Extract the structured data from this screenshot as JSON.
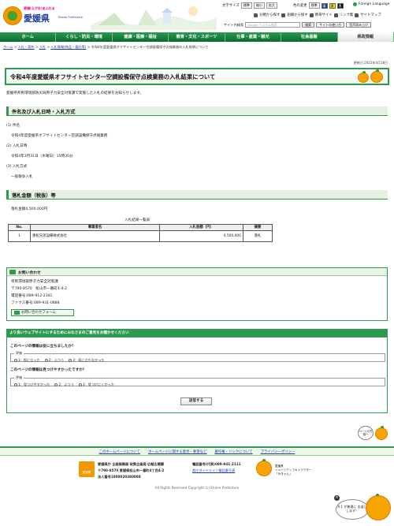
{
  "header": {
    "logo_tagline": "愛顔(えがお)あふれる",
    "logo_name": "愛媛県",
    "logo_en": "Ehime Prefecture",
    "text_size_label": "文字サイズ",
    "text_size_options": [
      "標準",
      "縮小",
      "拡大"
    ],
    "color_label": "色の変更",
    "color_options": [
      "標準",
      "青",
      "黄",
      "黒"
    ],
    "foreign_language": "Foreign Language",
    "util_links": [
      "分類から探す",
      "組織から探す",
      "携帯サイト",
      "リンク集",
      "サイトマップ"
    ],
    "search_label": "サイト内検索",
    "search_placeholder": "Google カスタム検索",
    "search_button": "検索",
    "howto_button": "サイトの使い方",
    "menu_button": "音声読み上げ"
  },
  "global_nav": [
    "ホーム",
    "くらし・防災・環境",
    "健康・医療・福祉",
    "教育・文化・スポーツ",
    "仕事・産業・観光",
    "社会基盤",
    "県政情報"
  ],
  "breadcrumb": [
    "ホーム",
    "入札・契約",
    "入札",
    "入札情報(物品・委託等)",
    "令和4年度愛媛県オフサイトセンター空調設備保守点検業務の入札結果について"
  ],
  "updated": "更新日:2022年4月18日",
  "page_title": "令和4年度愛媛県オフサイトセンター空調設備保守点検業務の入札結果について",
  "intro": "愛媛県県民環境部防災局原子力安全対策課で実施した入札の結果をお知らせします。",
  "section1": {
    "heading": "件名及び入札日時・入札方式",
    "items": [
      {
        "label": "(1) 件名",
        "value": "令和4年度愛媛県オフサイトセンター空調設備保守点検業務"
      },
      {
        "label": "(2) 入札日時",
        "value": "令和4年3月31日（木曜日）15時30分"
      },
      {
        "label": "(3) 入札方式",
        "value": "一般競争入札"
      }
    ]
  },
  "section2": {
    "heading": "落札金額（税抜）等",
    "amount": "落札金額4,500,000円",
    "table_caption": "入札結果一覧表",
    "columns": [
      "No.",
      "事業者名",
      "入札金額（円）",
      "摘要"
    ],
    "rows": [
      {
        "no": "1",
        "name": "重松兄弟設備株式会社",
        "amount": "4,500,000",
        "note": "落札"
      }
    ]
  },
  "contact": {
    "heading": "お問い合わせ",
    "lines": [
      "県民環境部原子力安全対策課",
      "〒790-8570　松山市一番町4-4-2",
      "電話番号:089-912-2341",
      "ファクス番号:089-931-0888"
    ],
    "form_button": "お問い合わせフォーム"
  },
  "survey": {
    "heading": "より良いウェブサイトにするためにみなさまのご意見をお聞かせください",
    "q1": "このページの情報は役に立ちましたか？",
    "q1_legend": "評価",
    "q1_options": [
      "1：役に立った",
      "2：ふつう",
      "3：役に立たなかった"
    ],
    "q2": "このページの情報は見つけやすかったですか？",
    "q2_legend": "評価",
    "q2_options": [
      "1：見つけやすかった",
      "2：ふつう",
      "3：見つけにくかった"
    ],
    "submit": "送信する"
  },
  "pagetop": "ページの先頭へ",
  "footer_nav": [
    "このホームページについて",
    "ホームページに関する意見・要望など",
    "著作権・リンクについて",
    "プライバシーポリシー"
  ],
  "footer": {
    "office_label": "愛媛県",
    "address1": "愛媛県庁 企画振興部 政策企画局 広報広聴課",
    "address2": "〒790-8570 愛媛県松山市一番町4丁目4-2",
    "corp_number": "法人番号1000020380008",
    "phone": "電話番号(代表)089-941-2111",
    "dial_link": "県庁ダイヤルイン電話番号表",
    "mascot_label": "愛媛県",
    "mascot_line2": "イメージアップキャラクター",
    "mascot_name": "「みきゃん」"
  },
  "copyright": "All Rights Reserved Copyright (c) Ehime Prefecture",
  "balloon": "A-1 が無理に お返しします！",
  "colors": {
    "green": "#2c9a50",
    "dark_green": "#0a6b30",
    "link": "#1a3c9c",
    "orange": "#f7a400"
  }
}
